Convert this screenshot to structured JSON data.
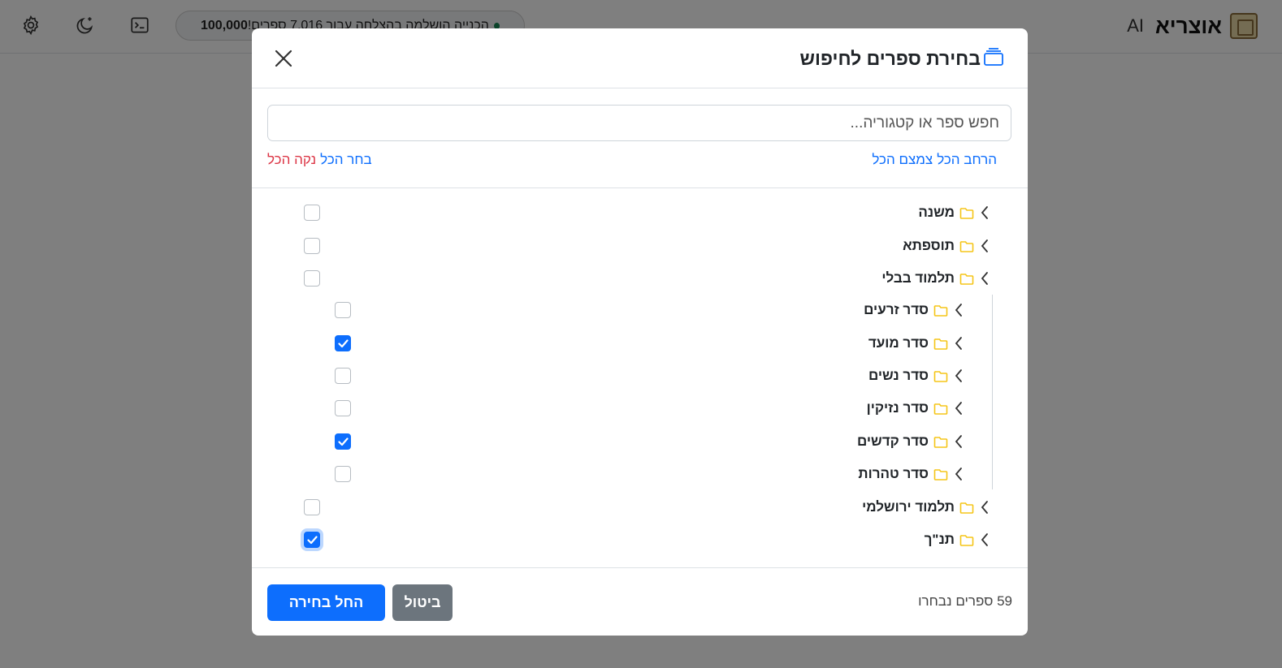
{
  "app": {
    "brand_name": "אוצריא",
    "brand_suffix": "AI",
    "status_message": "הכנייה הושלמה בהצלחה עבור 7,016 ספרים!",
    "status_count": "100,000"
  },
  "modal": {
    "title": "בחירת ספרים לחיפוש",
    "search_placeholder": "חפש ספר או קטגוריה...",
    "expand_all": "הרחב הכל",
    "collapse_all": "צמצם הכל",
    "select_all": "בחר הכל",
    "clear_all": "נקה הכל",
    "tree": [
      {
        "label": "משנה",
        "checked": false
      },
      {
        "label": "תוספתא",
        "checked": false
      },
      {
        "label": "תלמוד בבלי",
        "checked": false
      },
      {
        "label": "סדר זרעים",
        "checked": false
      },
      {
        "label": "סדר מועד",
        "checked": true
      },
      {
        "label": "סדר נשים",
        "checked": false
      },
      {
        "label": "סדר נזיקין",
        "checked": false
      },
      {
        "label": "סדר קדשים",
        "checked": true
      },
      {
        "label": "סדר טהרות",
        "checked": false
      },
      {
        "label": "תלמוד ירושלמי",
        "checked": false
      },
      {
        "label": "תנ\"ך",
        "checked": true
      }
    ],
    "selected_count": "59 ספרים נבחרו",
    "cancel_label": "ביטול",
    "start_label": "החל בחירה"
  },
  "colors": {
    "primary": "#0d6efd",
    "danger": "#dc3545",
    "secondary": "#6c757d",
    "folder": "#f5c518"
  },
  "icons": [
    "settings-icon",
    "dark-mode-icon",
    "terminal-icon",
    "close-icon",
    "folder-icon",
    "chevron-left-icon",
    "book-stack-icon",
    "check-icon"
  ]
}
